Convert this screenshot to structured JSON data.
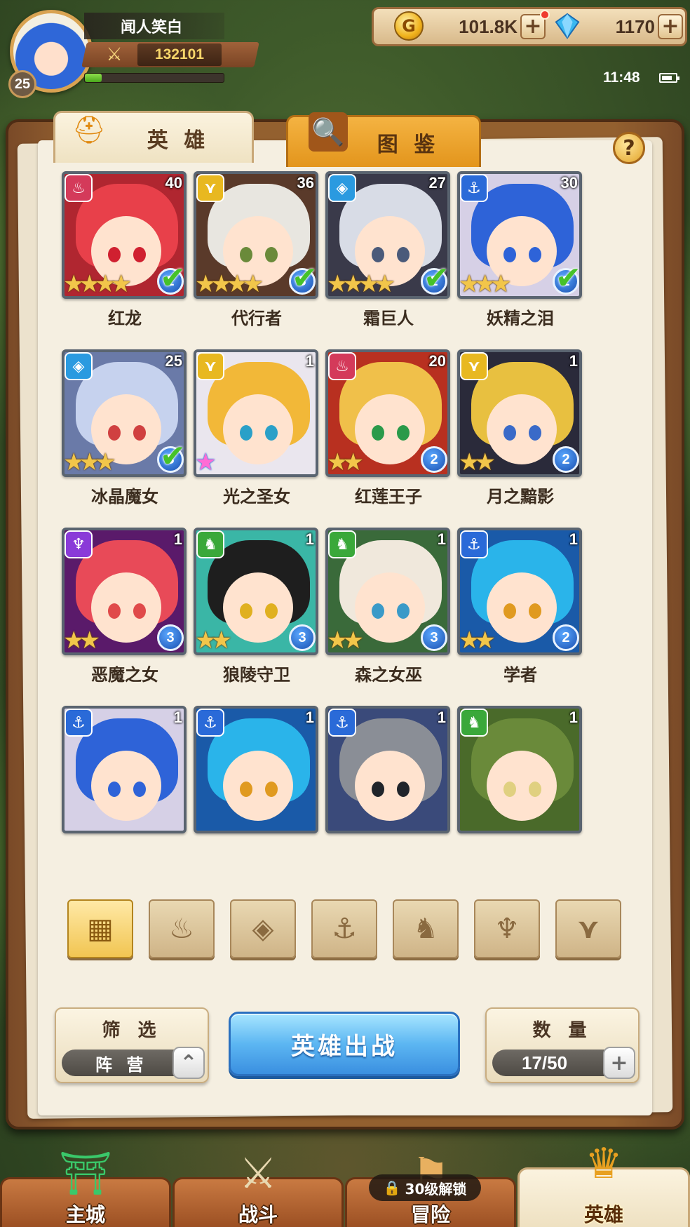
{
  "player": {
    "name": "闻人笑白",
    "level": "25",
    "power": "132101",
    "exp_progress": 0.12
  },
  "currency": {
    "gold": "101.8K",
    "gems": "1170"
  },
  "status": {
    "time": "11:48"
  },
  "tabs": {
    "heroes": "英 雄",
    "album": "图 鉴"
  },
  "heroes": [
    {
      "name": "红龙",
      "level": "40",
      "faction": "fire",
      "stars": 4,
      "rank": "2",
      "ready": true,
      "hair": "#e8404a",
      "bg": "#b02630",
      "eye": "#d02030"
    },
    {
      "name": "代行者",
      "level": "36",
      "faction": "light",
      "stars": 4,
      "rank": "3",
      "ready": true,
      "hair": "#e8e6e0",
      "bg": "#5a3a2a",
      "eye": "#6a8a3a"
    },
    {
      "name": "霜巨人",
      "level": "27",
      "faction": "ice",
      "stars": 4,
      "rank": "2",
      "ready": true,
      "hair": "#d8dce6",
      "bg": "#3a3a4a",
      "eye": "#4a5a7a"
    },
    {
      "name": "妖精之泪",
      "level": "30",
      "faction": "water",
      "stars": 3,
      "rank": "2",
      "ready": true,
      "hair": "#2e63d8",
      "bg": "#d6d0e6",
      "eye": "#2e63d8"
    },
    {
      "name": "冰晶魔女",
      "level": "25",
      "faction": "ice",
      "stars": 3,
      "rank": "3",
      "ready": true,
      "hair": "#c6d2ee",
      "bg": "#6a7aa8",
      "eye": "#d04040"
    },
    {
      "name": "光之圣女",
      "level": "1",
      "faction": "light",
      "stars": 1,
      "rank": "",
      "ready": false,
      "rainbow": true,
      "hair": "#f2b838",
      "bg": "#eae6ee",
      "eye": "#2aa0c8"
    },
    {
      "name": "红莲王子",
      "level": "20",
      "faction": "fire",
      "stars": 2,
      "rank": "2",
      "ready": false,
      "hair": "#f0c04a",
      "bg": "#b83020",
      "eye": "#2a9a4a"
    },
    {
      "name": "月之黯影",
      "level": "1",
      "faction": "light",
      "stars": 2,
      "rank": "2",
      "ready": false,
      "hair": "#e8c040",
      "bg": "#2a2a3a",
      "eye": "#3a6ac8"
    },
    {
      "name": "恶魔之女",
      "level": "1",
      "faction": "dark",
      "stars": 2,
      "rank": "3",
      "ready": false,
      "hair": "#e84a58",
      "bg": "#5a1a6a",
      "eye": "#e04a4a"
    },
    {
      "name": "狼陵守卫",
      "level": "1",
      "faction": "nature",
      "stars": 2,
      "rank": "3",
      "ready": false,
      "hair": "#1e1e1e",
      "bg": "#3ab6a6",
      "eye": "#e0b020"
    },
    {
      "name": "森之女巫",
      "level": "1",
      "faction": "nature",
      "stars": 2,
      "rank": "3",
      "ready": false,
      "hair": "#f0e8dc",
      "bg": "#3a6a3a",
      "eye": "#3a9ac8"
    },
    {
      "name": "学者",
      "level": "1",
      "faction": "water",
      "stars": 2,
      "rank": "2",
      "ready": false,
      "hair": "#2ab4ea",
      "bg": "#1a5aa8",
      "eye": "#e09a20"
    },
    {
      "name": "",
      "level": "1",
      "faction": "water",
      "stars": 0,
      "rank": "",
      "ready": false,
      "hair": "#2e63d8",
      "bg": "#d6d0e6",
      "eye": "#2e63d8"
    },
    {
      "name": "",
      "level": "1",
      "faction": "water",
      "stars": 0,
      "rank": "",
      "ready": false,
      "hair": "#2ab4ea",
      "bg": "#1a5aa8",
      "eye": "#e09a20"
    },
    {
      "name": "",
      "level": "1",
      "faction": "water",
      "stars": 0,
      "rank": "",
      "ready": false,
      "hair": "#8a8e96",
      "bg": "#3a4a7a",
      "eye": "#20242a"
    },
    {
      "name": "",
      "level": "1",
      "faction": "nature",
      "stars": 0,
      "rank": "",
      "ready": false,
      "hair": "#6a8a3a",
      "bg": "#4a6a2a",
      "eye": "#e0d080"
    }
  ],
  "faction_colors": {
    "fire": "#d43a5a",
    "light": "#e8b820",
    "ice": "#2a9ae0",
    "water": "#2a6ad8",
    "dark": "#8a3ad8",
    "nature": "#3aa83a"
  },
  "filters": [
    {
      "icon": "grid-icon",
      "glyph": "▦",
      "active": true
    },
    {
      "icon": "fire-faction-icon",
      "glyph": "♨",
      "active": false
    },
    {
      "icon": "ice-faction-icon",
      "glyph": "◈",
      "active": false
    },
    {
      "icon": "anchor-faction-icon",
      "glyph": "⚓",
      "active": false
    },
    {
      "icon": "beast-faction-icon",
      "glyph": "♞",
      "active": false
    },
    {
      "icon": "dark-faction-icon",
      "glyph": "♆",
      "active": false
    },
    {
      "icon": "light-faction-icon",
      "glyph": "⋎",
      "active": false
    }
  ],
  "controls": {
    "filter_title": "筛 选",
    "filter_value": "阵 营",
    "deploy_label": "英雄出战",
    "count_title": "数 量",
    "count_value": "17/50"
  },
  "nav": {
    "city": "主城",
    "battle": "战斗",
    "adventure": "冒险",
    "heroes": "英雄",
    "lock_label": "30级解锁"
  }
}
